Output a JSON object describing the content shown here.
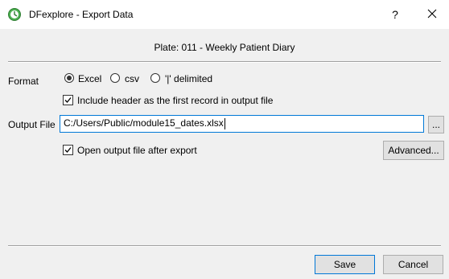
{
  "window": {
    "title": "DFexplore - Export Data",
    "help_label": "?"
  },
  "plate_label": "Plate: 011 - Weekly Patient Diary",
  "format": {
    "label": "Format",
    "options": [
      "Excel",
      "csv",
      "'|' delimited"
    ],
    "selected": "Excel"
  },
  "include_header": {
    "label": "Include header as the first record in output file",
    "checked": true
  },
  "output_file": {
    "label": "Output File",
    "value": "C:/Users/Public/module15_dates.xlsx",
    "browse_label": "..."
  },
  "open_after": {
    "label": "Open output file after export",
    "checked": true
  },
  "advanced_label": "Advanced...",
  "buttons": {
    "save": "Save",
    "cancel": "Cancel"
  },
  "icons": {
    "app": "dfexplore-app-icon",
    "close": "close-icon",
    "check": "checkmark-icon"
  },
  "colors": {
    "focus_border": "#0078d7",
    "app_icon": "#5cb85c"
  }
}
